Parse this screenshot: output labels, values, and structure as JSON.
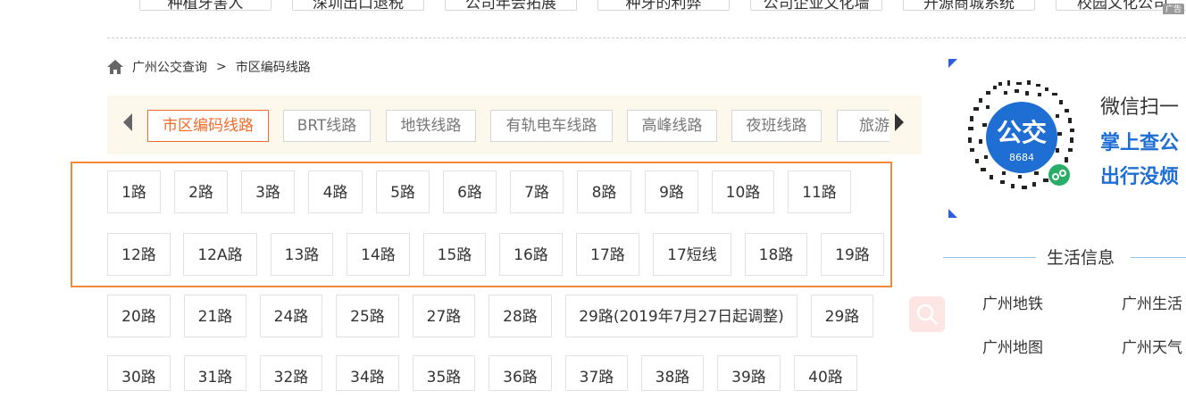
{
  "ads": [
    "种植牙害人",
    "深圳出口退税",
    "公司年会拓展",
    "种牙的利弊",
    "公司企业文化墙",
    "开源商城系统",
    "校园文化公司"
  ],
  "ad_mark": "广告",
  "breadcrumb": {
    "home": "广州公交查询",
    "sep": ">",
    "current": "市区编码线路"
  },
  "tabs": [
    "市区编码线路",
    "BRT线路",
    "地铁线路",
    "有轨电车线路",
    "高峰线路",
    "夜班线路",
    "旅游线"
  ],
  "routes": {
    "row1": [
      "1路",
      "2路",
      "3路",
      "4路",
      "5路",
      "6路",
      "7路",
      "8路",
      "9路",
      "10路",
      "11路"
    ],
    "row2": [
      "12路",
      "12A路",
      "13路",
      "14路",
      "15路",
      "16路",
      "17路",
      "17短线",
      "18路",
      "19路"
    ],
    "row3": [
      "20路",
      "21路",
      "24路",
      "25路",
      "27路",
      "28路",
      "29路(2019年7月27日起调整)",
      "29路"
    ],
    "row4": [
      "30路",
      "31路",
      "32路",
      "34路",
      "35路",
      "36路",
      "37路",
      "38路",
      "39路",
      "40路"
    ]
  },
  "qr": {
    "badge_line1": "公交",
    "badge_line2": "8684",
    "text1": "微信扫一",
    "text2": "掌上查公",
    "text3": "出行没烦"
  },
  "life": {
    "title": "生活信息",
    "links": [
      "广州地铁",
      "广州生活",
      "广州地图",
      "广州天气"
    ]
  },
  "colors": {
    "accent": "#f26b2a",
    "highlight": "#f08a3a",
    "brand_blue": "#1f6ed4",
    "tabbar_bg": "#fdf8ec"
  }
}
